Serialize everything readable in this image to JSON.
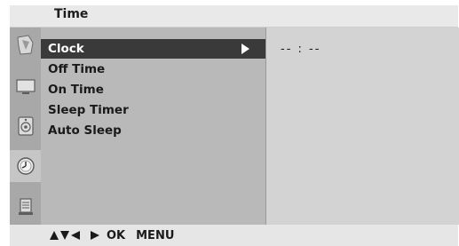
{
  "header": {
    "title": "Time"
  },
  "sidebar": {
    "icons": [
      {
        "name": "picture-icon",
        "active": false
      },
      {
        "name": "screen-icon",
        "active": false
      },
      {
        "name": "audio-icon",
        "active": false
      },
      {
        "name": "time-icon",
        "active": true
      },
      {
        "name": "special-icon",
        "active": false
      }
    ]
  },
  "menu": {
    "items": [
      {
        "label": "Clock",
        "selected": true
      },
      {
        "label": "Off Time",
        "selected": false
      },
      {
        "label": "On Time",
        "selected": false
      },
      {
        "label": "Sleep Timer",
        "selected": false
      },
      {
        "label": "Auto Sleep",
        "selected": false
      }
    ]
  },
  "submenu": {
    "clock_value": "-- : --"
  },
  "footer": {
    "ok_label": "OK",
    "menu_label": "MENU"
  },
  "colors": {
    "selected_bg": "#3a3a3a",
    "panel_bg": "#b9b9b9",
    "icon_column_bg": "#a8a8a8"
  }
}
